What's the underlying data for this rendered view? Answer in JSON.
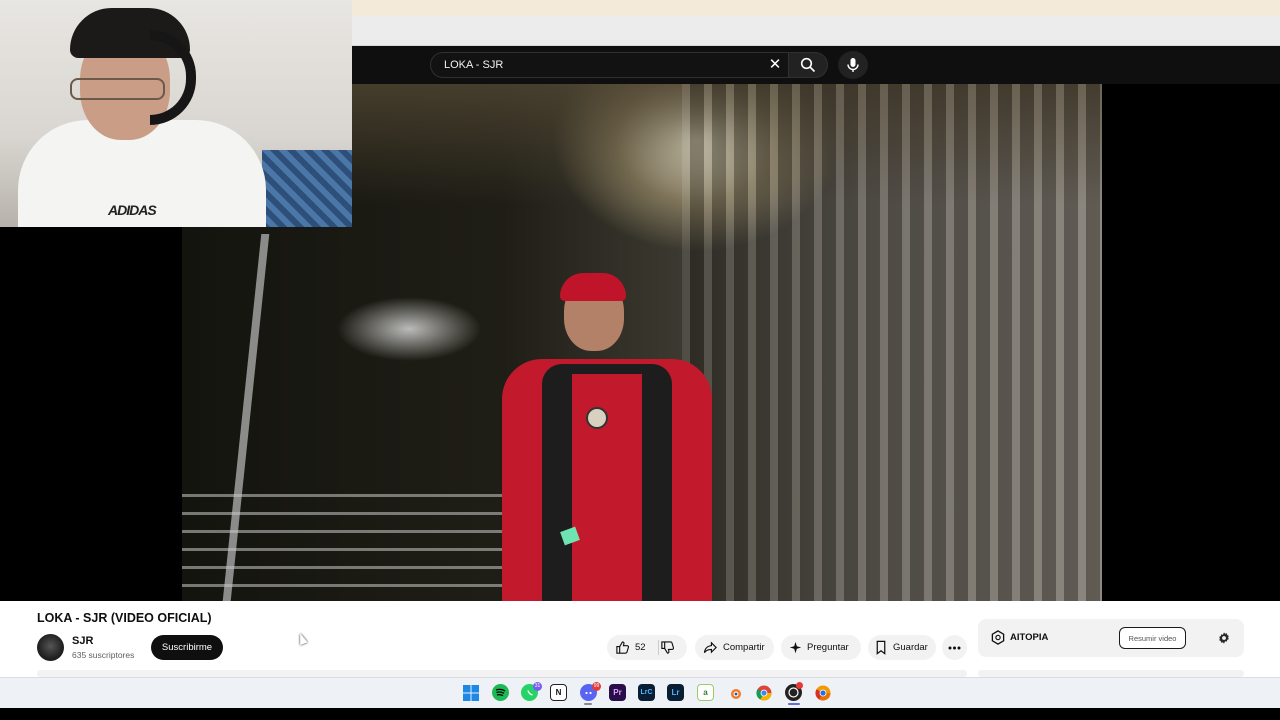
{
  "search": {
    "query": "LOKA - SJR"
  },
  "video": {
    "title": "LOKA - SJR (VIDEO OFICIAL)"
  },
  "channel": {
    "name": "SJR",
    "subscribers": "635 suscriptores",
    "subscribe_label": "Suscribirme"
  },
  "actions": {
    "like_count": "52",
    "share_label": "Compartir",
    "ask_label": "Preguntar",
    "save_label": "Guardar"
  },
  "aitopia": {
    "label": "AITOPIA",
    "summarize_label": "Resumir video"
  },
  "webcam": {
    "shirt_logo": "ADIDAS"
  },
  "taskbar": {
    "icons": [
      "windows-start",
      "spotify",
      "whatsapp",
      "notion",
      "discord",
      "premiere-pro",
      "lightroom-classic",
      "lightroom",
      "android-studio",
      "blender",
      "chrome",
      "obs",
      "chrome-canary"
    ],
    "whatsapp_badge": "31",
    "discord_badge": "99"
  },
  "colors": {
    "youtube_dark": "#0f0f0f",
    "pill_bg": "#f2f2f2",
    "accent_red": "#c21a2c"
  }
}
